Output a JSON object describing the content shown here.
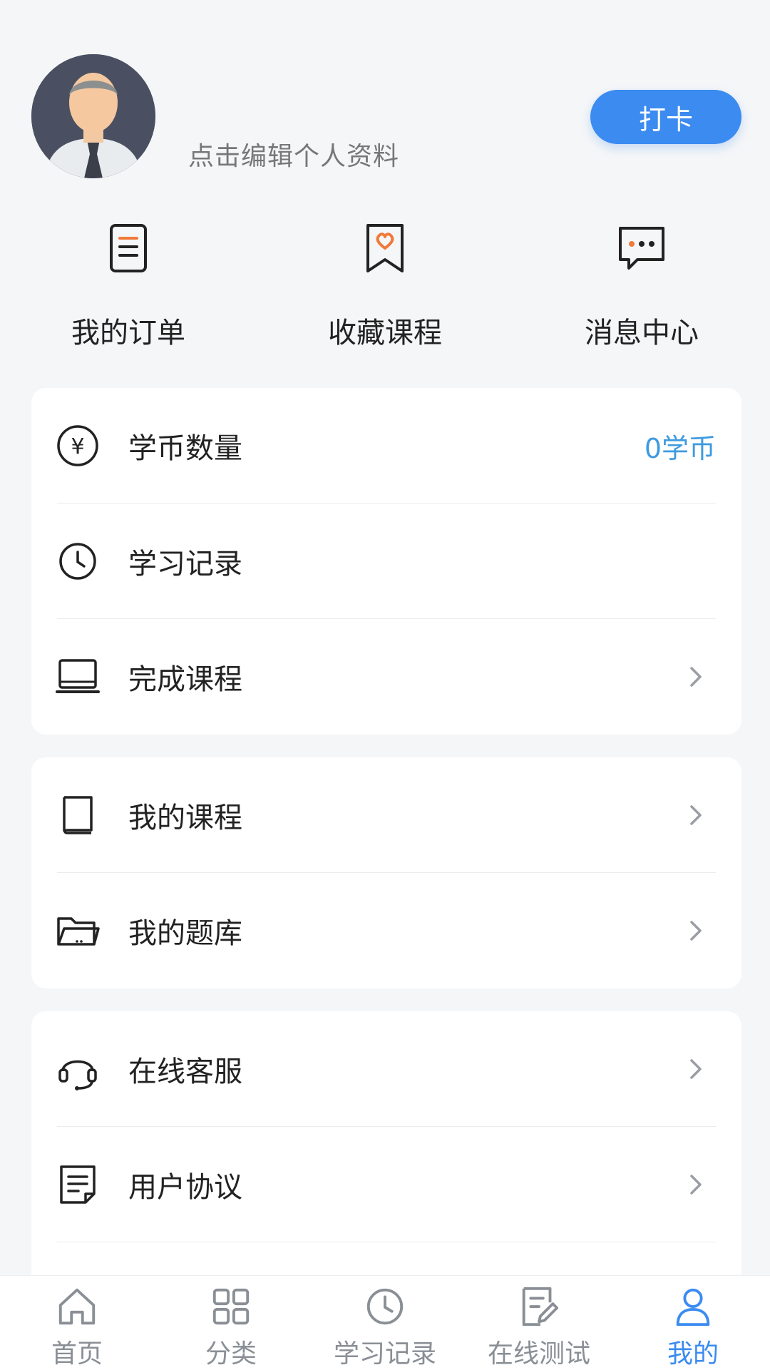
{
  "profile": {
    "edit_hint": "点击编辑个人资料",
    "checkin_label": "打卡"
  },
  "quick_actions": [
    {
      "label": "我的订单",
      "icon": "order-icon"
    },
    {
      "label": "收藏课程",
      "icon": "favorite-icon"
    },
    {
      "label": "消息中心",
      "icon": "message-icon"
    }
  ],
  "menu": {
    "coins": {
      "label": "学币数量",
      "value": "0学币",
      "icon": "yen-coin-icon"
    },
    "study_record": {
      "label": "学习记录",
      "icon": "clock-icon"
    },
    "finished_courses": {
      "label": "完成课程",
      "icon": "laptop-icon"
    },
    "my_courses": {
      "label": "我的课程",
      "icon": "book-icon"
    },
    "my_question_bank": {
      "label": "我的题库",
      "icon": "folder-icon"
    },
    "customer_service": {
      "label": "在线客服",
      "icon": "headset-icon"
    },
    "user_agreement": {
      "label": "用户协议",
      "icon": "document-icon"
    }
  },
  "bottom_nav": [
    {
      "label": "首页",
      "icon": "home-icon",
      "active": false
    },
    {
      "label": "分类",
      "icon": "grid-icon",
      "active": false
    },
    {
      "label": "学习记录",
      "icon": "clock-icon",
      "active": false
    },
    {
      "label": "在线测试",
      "icon": "edit-doc-icon",
      "active": false
    },
    {
      "label": "我的",
      "icon": "user-icon",
      "active": true
    }
  ],
  "colors": {
    "accent": "#3b8bf0",
    "coin_value": "#3f9be0",
    "icon_orange": "#f07a3a",
    "background": "#f5f6f8"
  }
}
